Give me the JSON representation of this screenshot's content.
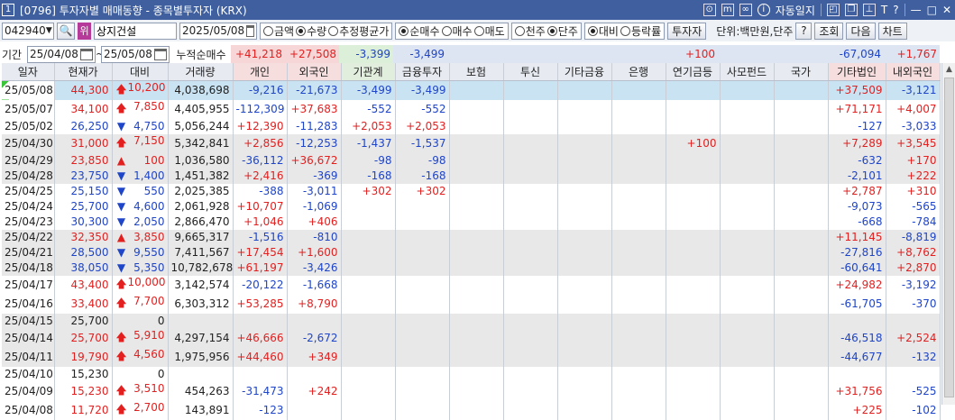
{
  "window": {
    "number": "1",
    "title": "[0796] 투자자별 매매동향 - 종목별투자자 (KRX)",
    "auto_update_label": "자동일지"
  },
  "toolbar": {
    "code": "042940",
    "badge": "위",
    "stock_name": "상지건설",
    "date": "2025/05/08",
    "unit_options": [
      {
        "label": "금액",
        "checked": false
      },
      {
        "label": "수량",
        "checked": true
      },
      {
        "label": "추정평균가",
        "checked": false
      }
    ],
    "trade_options": [
      {
        "label": "순매수",
        "checked": true
      },
      {
        "label": "매수",
        "checked": false
      },
      {
        "label": "매도",
        "checked": false
      }
    ],
    "price_options": [
      {
        "label": "천주",
        "checked": false
      },
      {
        "label": "단주",
        "checked": true
      }
    ],
    "compare_options": [
      {
        "label": "대비",
        "checked": true
      },
      {
        "label": "등락률",
        "checked": false
      }
    ],
    "investor_button": "투자자",
    "unit_text": "단위:백만원,단주",
    "help_button": "?",
    "query_button": "조회",
    "next_button": "다음",
    "chart_button": "차트"
  },
  "period": {
    "label": "기간",
    "from": "25/04/08",
    "to": "25/05/08",
    "cum_label": "누적순매수",
    "sums": {
      "individual": "+41,218",
      "foreign": "+27,508",
      "institution": "-3,399",
      "finance": "-3,499",
      "pension": "+100",
      "other_corp": "-67,094",
      "domestic_foreign": "+1,767"
    }
  },
  "columns": [
    "일자",
    "현재가",
    "대비",
    "거래량",
    "개인",
    "외국인",
    "기관계",
    "금융투자",
    "보험",
    "투신",
    "기타금융",
    "은행",
    "연기금등",
    "사모펀드",
    "국가",
    "기타법인",
    "내외국인"
  ],
  "rows": [
    {
      "date": "25/05/08",
      "price": "44,300",
      "dir": "up",
      "chg": "10,200",
      "vol": "4,038,698",
      "ind": "-9,216",
      "frn": "-21,673",
      "inst": "-3,499",
      "fin": "-3,499",
      "pen": "",
      "oth": "+37,509",
      "dfo": "-3,121"
    },
    {
      "date": "25/05/07",
      "price": "34,100",
      "dir": "up",
      "chg": "7,850",
      "vol": "4,405,955",
      "ind": "-112,309",
      "frn": "+37,683",
      "inst": "-552",
      "fin": "-552",
      "pen": "",
      "oth": "+71,171",
      "dfo": "+4,007"
    },
    {
      "date": "25/05/02",
      "price": "26,250",
      "dir": "down",
      "chg": "4,750",
      "vol": "5,056,244",
      "ind": "+12,390",
      "frn": "-11,283",
      "inst": "+2,053",
      "fin": "+2,053",
      "pen": "",
      "oth": "-127",
      "dfo": "-3,033"
    },
    {
      "date": "25/04/30",
      "price": "31,000",
      "dir": "up",
      "chg": "7,150",
      "vol": "5,342,841",
      "ind": "+2,856",
      "frn": "-12,253",
      "inst": "-1,437",
      "fin": "-1,537",
      "pen": "+100",
      "oth": "+7,289",
      "dfo": "+3,545"
    },
    {
      "date": "25/04/29",
      "price": "23,850",
      "dir": "upsm",
      "chg": "100",
      "vol": "1,036,580",
      "ind": "-36,112",
      "frn": "+36,672",
      "inst": "-98",
      "fin": "-98",
      "pen": "",
      "oth": "-632",
      "dfo": "+170"
    },
    {
      "date": "25/04/28",
      "price": "23,750",
      "dir": "down",
      "chg": "1,400",
      "vol": "1,451,382",
      "ind": "+2,416",
      "frn": "-369",
      "inst": "-168",
      "fin": "-168",
      "pen": "",
      "oth": "-2,101",
      "dfo": "+222"
    },
    {
      "date": "25/04/25",
      "price": "25,150",
      "dir": "down",
      "chg": "550",
      "vol": "2,025,385",
      "ind": "-388",
      "frn": "-3,011",
      "inst": "+302",
      "fin": "+302",
      "pen": "",
      "oth": "+2,787",
      "dfo": "+310"
    },
    {
      "date": "25/04/24",
      "price": "25,700",
      "dir": "down",
      "chg": "4,600",
      "vol": "2,061,928",
      "ind": "+10,707",
      "frn": "-1,069",
      "inst": "",
      "fin": "",
      "pen": "",
      "oth": "-9,073",
      "dfo": "-565"
    },
    {
      "date": "25/04/23",
      "price": "30,300",
      "dir": "down",
      "chg": "2,050",
      "vol": "2,866,470",
      "ind": "+1,046",
      "frn": "+406",
      "inst": "",
      "fin": "",
      "pen": "",
      "oth": "-668",
      "dfo": "-784"
    },
    {
      "date": "25/04/22",
      "price": "32,350",
      "dir": "upsm",
      "chg": "3,850",
      "vol": "9,665,317",
      "ind": "-1,516",
      "frn": "-810",
      "inst": "",
      "fin": "",
      "pen": "",
      "oth": "+11,145",
      "dfo": "-8,819"
    },
    {
      "date": "25/04/21",
      "price": "28,500",
      "dir": "down",
      "chg": "9,550",
      "vol": "7,411,567",
      "ind": "+17,454",
      "frn": "+1,600",
      "inst": "",
      "fin": "",
      "pen": "",
      "oth": "-27,816",
      "dfo": "+8,762"
    },
    {
      "date": "25/04/18",
      "price": "38,050",
      "dir": "down",
      "chg": "5,350",
      "vol": "10,782,678",
      "ind": "+61,197",
      "frn": "-3,426",
      "inst": "",
      "fin": "",
      "pen": "",
      "oth": "-60,641",
      "dfo": "+2,870"
    },
    {
      "date": "25/04/17",
      "price": "43,400",
      "dir": "up",
      "chg": "10,000",
      "vol": "3,142,574",
      "ind": "-20,122",
      "frn": "-1,668",
      "inst": "",
      "fin": "",
      "pen": "",
      "oth": "+24,982",
      "dfo": "-3,192"
    },
    {
      "date": "25/04/16",
      "price": "33,400",
      "dir": "up",
      "chg": "7,700",
      "vol": "6,303,312",
      "ind": "+53,285",
      "frn": "+8,790",
      "inst": "",
      "fin": "",
      "pen": "",
      "oth": "-61,705",
      "dfo": "-370"
    },
    {
      "date": "25/04/15",
      "price": "25,700",
      "dir": "none",
      "chg": "0",
      "vol": "",
      "ind": "",
      "frn": "",
      "inst": "",
      "fin": "",
      "pen": "",
      "oth": "",
      "dfo": ""
    },
    {
      "date": "25/04/14",
      "price": "25,700",
      "dir": "up",
      "chg": "5,910",
      "vol": "4,297,154",
      "ind": "+46,666",
      "frn": "-2,672",
      "inst": "",
      "fin": "",
      "pen": "",
      "oth": "-46,518",
      "dfo": "+2,524"
    },
    {
      "date": "25/04/11",
      "price": "19,790",
      "dir": "up",
      "chg": "4,560",
      "vol": "1,975,956",
      "ind": "+44,460",
      "frn": "+349",
      "inst": "",
      "fin": "",
      "pen": "",
      "oth": "-44,677",
      "dfo": "-132"
    },
    {
      "date": "25/04/10",
      "price": "15,230",
      "dir": "none",
      "chg": "0",
      "vol": "",
      "ind": "",
      "frn": "",
      "inst": "",
      "fin": "",
      "pen": "",
      "oth": "",
      "dfo": ""
    },
    {
      "date": "25/04/09",
      "price": "15,230",
      "dir": "up",
      "chg": "3,510",
      "vol": "454,263",
      "ind": "-31,473",
      "frn": "+242",
      "inst": "",
      "fin": "",
      "pen": "",
      "oth": "+31,756",
      "dfo": "-525"
    },
    {
      "date": "25/04/08",
      "price": "11,720",
      "dir": "up",
      "chg": "2,700",
      "vol": "143,891",
      "ind": "-123",
      "frn": "",
      "inst": "",
      "fin": "",
      "pen": "",
      "oth": "+225",
      "dfo": "-102"
    }
  ],
  "colors": {
    "up": "#e32020",
    "down": "#1f45c8",
    "selected_row": "#c9e3f2",
    "gray_row": "#e8e8e8",
    "title_bar": "#3f5f9e"
  }
}
